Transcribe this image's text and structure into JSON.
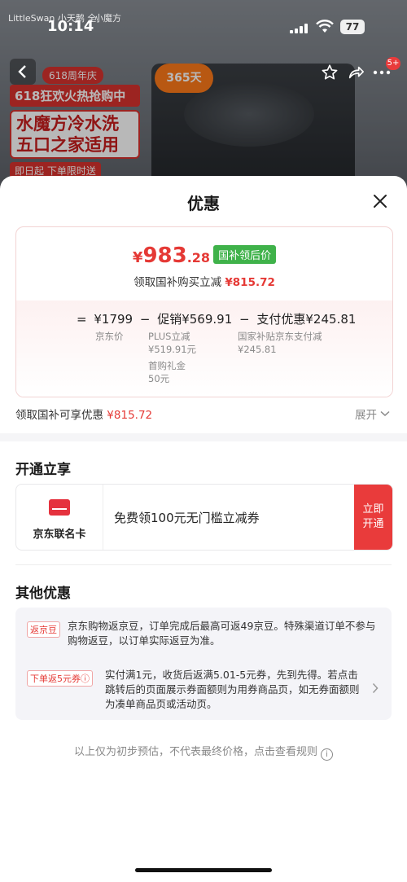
{
  "status_bar": {
    "time": "10:14",
    "battery": "77",
    "brand_left": "LittleSwan 小天鹅 全心全意",
    "brand_right": "小魔方"
  },
  "background_promo": {
    "badge_618": "618周年庆",
    "line1": "618狂欢火热抢购中",
    "line2": "水魔方冷水洗 五口之家适用",
    "line3": "即日起  下单限时送",
    "badge_365": "365天",
    "message_count": "5+"
  },
  "sheet": {
    "title": "优惠",
    "price": {
      "yen": "¥",
      "integer": "983",
      "decimal": ".28",
      "tag": "国补领后价"
    },
    "claim_line": {
      "text": "领取国补购买立减",
      "amount": "¥815.72"
    },
    "formula": {
      "eq": "=",
      "jd_price": "¥1799",
      "minus1": "−",
      "promo": "促销¥569.91",
      "minus2": "−",
      "pay": "支付优惠¥245.81",
      "jd_price_label": "京东价",
      "plus_label": "PLUS立减",
      "plus_value": "¥519.91元",
      "first_gift_label": "首购礼金",
      "first_gift_value": "50元",
      "gov_label": "国家补贴京东支付减",
      "gov_value": "¥245.81"
    },
    "gov_line": {
      "text": "领取国补可享优惠",
      "amount": "¥815.72"
    },
    "expand_label": "展开",
    "open_section": {
      "title": "开通立享",
      "card_name": "京东联名卡",
      "offer": "免费领100元无门槛立减券",
      "button": "立即\n开通"
    },
    "other_section": {
      "title": "其他优惠",
      "items": [
        {
          "tag": "返京豆",
          "text": "京东购物返京豆，订单完成后最高可返49京豆。特殊渠道订单不参与购物返豆，以订单实际返豆为准。"
        },
        {
          "tag": "下单返5元券ⓘ",
          "text": "实付满1元，收货后返满5.01-5元券，先到先得。若点击跳转后的页面展示券面额则为用券商品页，如无券面额则为凑单商品页或活动页。"
        }
      ]
    },
    "footer_note": "以上仅为初步预估，不代表最终价格，点击查看规则"
  }
}
